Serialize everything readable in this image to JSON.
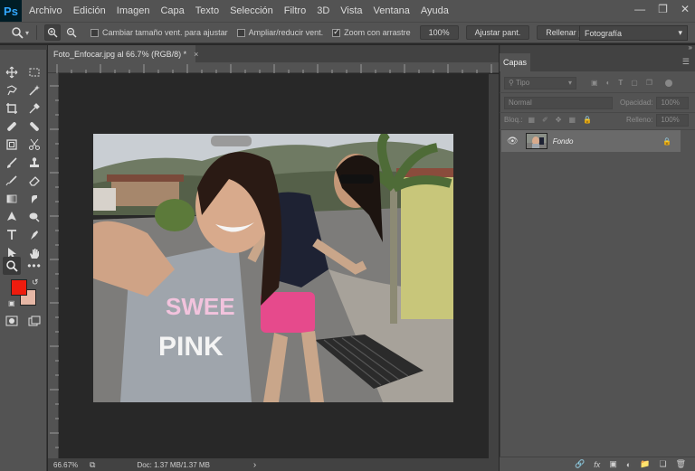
{
  "app": {
    "logo": "Ps"
  },
  "menu": [
    "Archivo",
    "Edición",
    "Imagen",
    "Capa",
    "Texto",
    "Selección",
    "Filtro",
    "3D",
    "Vista",
    "Ventana",
    "Ayuda"
  ],
  "options": {
    "resize_windows_label": "Cambiar tamaño vent. para ajustar",
    "zoom_all_label": "Ampliar/reducir vent.",
    "scrubby_zoom_label": "Zoom con arrastre",
    "zoom_100_label": "100%",
    "fit_screen_label": "Ajustar pant.",
    "fill_screen_label": "Rellenar pant.",
    "workspace_value": "Fotografía"
  },
  "document": {
    "tab_title": "Foto_Enfocar.jpg al 66.7% (RGB/8) *",
    "close_glyph": "×"
  },
  "status": {
    "zoom": "66.67%",
    "doc_info": "Doc: 1.37 MB/1.37 MB",
    "arrow": "›"
  },
  "layers_panel": {
    "tab_label": "Capas",
    "filter_placeholder": "Tipo",
    "blend_mode": "Normal",
    "opacity_label": "Opacidad:",
    "opacity_value": "100%",
    "lock_label": "Bloq.:",
    "fill_label": "Relleno:",
    "fill_value": "100%",
    "layer_name": "Fondo"
  },
  "colors": {
    "foreground": "#ee1c0e",
    "background": "#e6b7a6",
    "accent_logo": "#31a8ff"
  }
}
